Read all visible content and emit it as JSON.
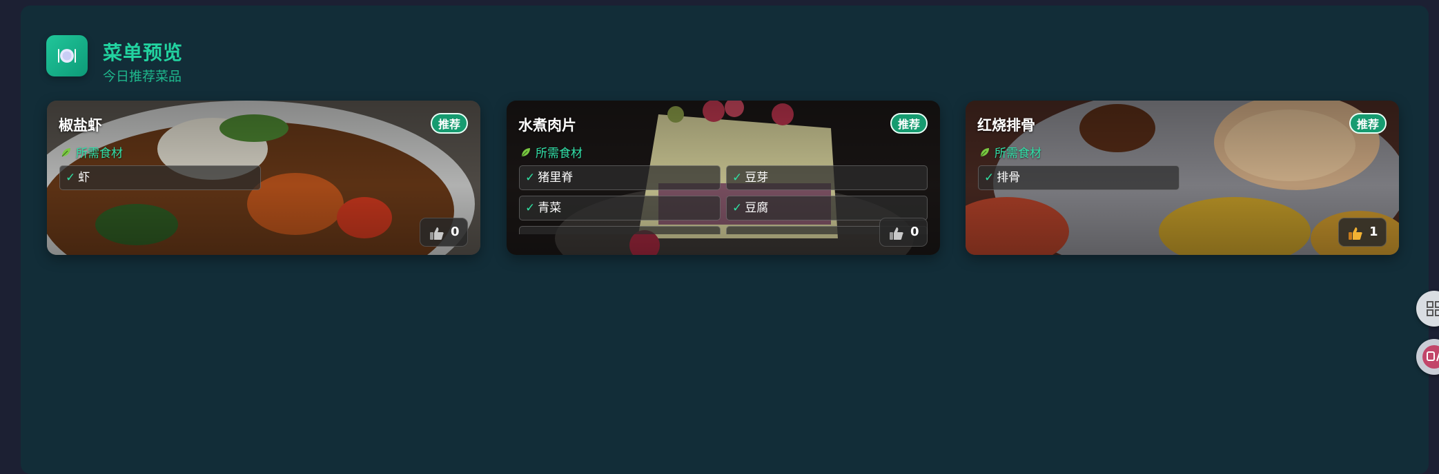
{
  "header": {
    "title": "菜单预览",
    "subtitle": "今日推荐菜品",
    "icon": "plate-cutlery-icon"
  },
  "colors": {
    "accent": "#22d3a0",
    "panel": "#122d38",
    "badge": "#169b70",
    "check": "#2fe0a2"
  },
  "cards": [
    {
      "name": "椒盐虾",
      "badge": "推荐",
      "ingredients_title": "所需食材",
      "ingredients": [
        "虾"
      ],
      "likes": "0"
    },
    {
      "name": "水煮肉片",
      "badge": "推荐",
      "ingredients_title": "所需食材",
      "ingredients": [
        "猪里脊",
        "豆芽",
        "青菜",
        "豆腐"
      ],
      "likes": "0"
    },
    {
      "name": "红烧排骨",
      "badge": "推荐",
      "ingredients_title": "所需食材",
      "ingredients": [
        "排骨"
      ],
      "likes": "1"
    }
  ],
  "side_tools": [
    {
      "icon": "grid-apps-icon"
    },
    {
      "icon": "translate-icon"
    }
  ]
}
